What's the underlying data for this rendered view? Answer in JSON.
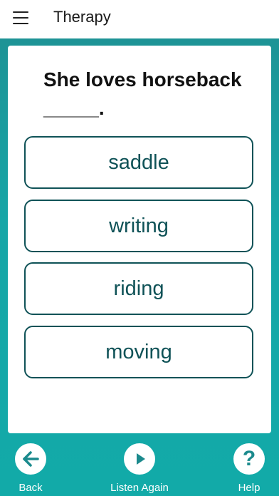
{
  "appbar": {
    "title": "Therapy",
    "menu_icon": "hamburger-menu-icon"
  },
  "question": {
    "prompt": "She loves horseback _____."
  },
  "options": [
    {
      "label": "saddle"
    },
    {
      "label": "writing"
    },
    {
      "label": "riding"
    },
    {
      "label": "moving"
    }
  ],
  "bottom_nav": {
    "back": {
      "label": "Back",
      "icon": "arrow-left-icon"
    },
    "listen": {
      "label": "Listen Again",
      "icon": "play-icon"
    },
    "help": {
      "label": "Help",
      "icon": "question-mark-icon"
    }
  },
  "colors": {
    "accent": "#0f5257",
    "background": "#17a6a7",
    "card": "#ffffff"
  }
}
